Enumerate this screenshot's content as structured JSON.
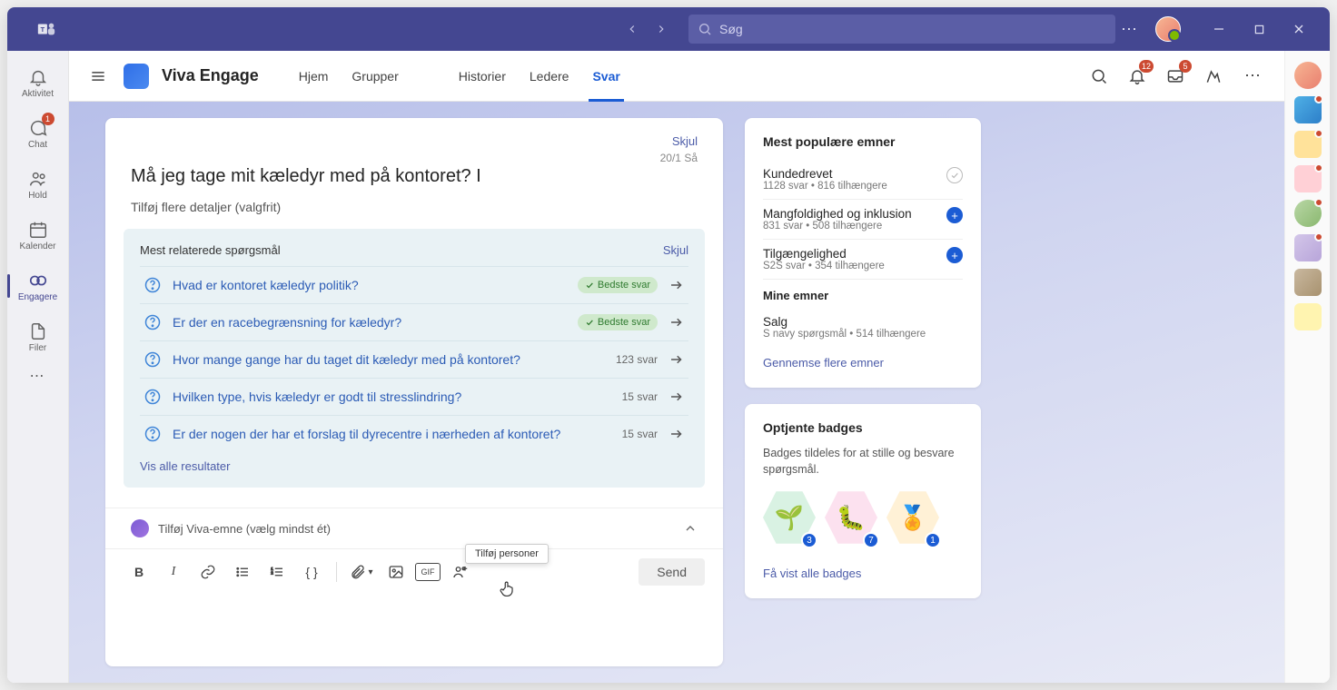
{
  "titlebar": {
    "search_placeholder": "Søg"
  },
  "leftRail": {
    "activity": "Aktivitet",
    "chat": "Chat",
    "chat_badge": "1",
    "teams": "Hold",
    "calendar": "Kalender",
    "engage": "Engagere",
    "files": "Filer"
  },
  "header": {
    "app_title": "Viva Engage",
    "tabs": {
      "home": "Hjem",
      "groups": "Grupper",
      "stories": "Historier",
      "leaders": "Ledere",
      "answers": "Svar"
    },
    "notif_badge": "12",
    "inbox_badge": "5"
  },
  "compose": {
    "hide": "Skjul",
    "date": "20/1",
    "ago": "Så",
    "title": "Må jeg tage mit kæledyr med på kontoret? I",
    "subtitle": "Tilføj flere detaljer (valgfrit)",
    "related_title": "Mest relaterede spørgsmål",
    "related_hide": "Skjul",
    "best_answer": "Bedste svar",
    "answers_word": "svar",
    "questions": [
      {
        "text": "Hvad er kontoret kæledyr politik?",
        "best": true
      },
      {
        "text": "Er der en racebegrænsning for kæledyr?",
        "best": true
      },
      {
        "text": "Hvor mange gange har du taget dit kæledyr med på kontoret?",
        "count": "123"
      },
      {
        "text": "Hvilken type, hvis kæledyr er godt til stresslindring?",
        "count": "15"
      },
      {
        "text": "Er der nogen der har et forslag til dyrecentre i nærheden af kontoret?",
        "count": "15"
      }
    ],
    "view_all": "Vis alle resultater",
    "add_topic": "Tilføj Viva-emne (vælg mindst ét)",
    "tooltip": "Tilføj personer",
    "send": "Send"
  },
  "side": {
    "popular_title": "Mest populære emner",
    "topics": [
      {
        "name": "Kundedrevet",
        "meta": "1128 svar • 816 tilhængere",
        "badge": "check"
      },
      {
        "name": "Mangfoldighed og inklusion",
        "meta": "831 svar • 508 tilhængere",
        "badge": "plus"
      },
      {
        "name": "Tilgængelighed",
        "meta": "S2S svar • 354 tilhængere",
        "badge": "plus"
      }
    ],
    "my_topics_title": "Mine emner",
    "my_topic": {
      "name": "Salg",
      "meta": "S navy spørgsmål • 514 tilhængere"
    },
    "browse": "Gennemse flere emner",
    "badges_title": "Optjente badges",
    "badges_desc": "Badges tildeles for at stille og besvare spørgsmål.",
    "badge_counts": [
      "3",
      "7",
      "1"
    ],
    "view_badges": "Få vist alle badges"
  }
}
